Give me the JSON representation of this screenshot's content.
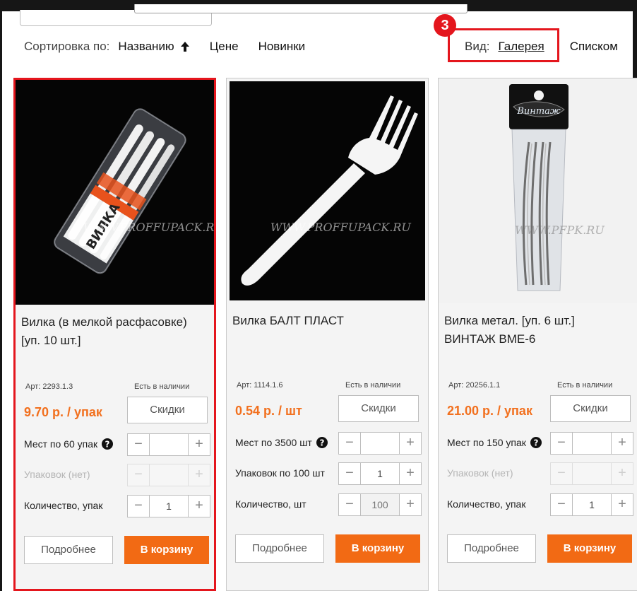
{
  "sort": {
    "label": "Сортировка по:",
    "options": [
      "Названию",
      "Цене",
      "Новинки"
    ]
  },
  "view": {
    "label": "Вид:",
    "gallery": "Галерея",
    "list": "Списком"
  },
  "step_badge": "3",
  "colors": {
    "accent": "#f26a14",
    "price": "#f2701e",
    "highlight": "#e4161d"
  },
  "products": [
    {
      "name": "Вилка (в мелкой расфасовке) [уп. 10 шт.]",
      "watermark": "WWW.PROFFUPACK.RU",
      "package_text": "ВИЛКА",
      "art": "Арт: 2293.1.3",
      "availability": "Есть в наличии",
      "price": "9.70 р. / упак",
      "discount_btn": "Скидки",
      "places_label": "Мест по 60 упак",
      "places_value": "",
      "packs_label": "Упаковок (нет)",
      "packs_value": "",
      "qty_label": "Количество, упак",
      "qty_value": "1",
      "more_btn": "Подробнее",
      "cart_btn": "В корзину"
    },
    {
      "name": "Вилка БАЛТ ПЛАСТ",
      "watermark": "WWW.PROFFUPACK.RU",
      "art": "Арт: 1114.1.6",
      "availability": "Есть в наличии",
      "price": "0.54 р. / шт",
      "discount_btn": "Скидки",
      "places_label": "Мест по 3500 шт",
      "places_value": "",
      "packs_label": "Упаковок по 100 шт",
      "packs_value": "1",
      "qty_label": "Количество, шт",
      "qty_value": "100",
      "more_btn": "Подробнее",
      "cart_btn": "В корзину"
    },
    {
      "name": "Вилка метал. [уп. 6 шт.] ВИНТАЖ ВМЕ-6",
      "watermark": "WWW.PFPK.RU",
      "package_text": "Винтаж",
      "art": "Арт: 20256.1.1",
      "availability": "Есть в наличии",
      "price": "21.00 р. / упак",
      "discount_btn": "Скидки",
      "places_label": "Мест по 150 упак",
      "places_value": "",
      "packs_label": "Упаковок (нет)",
      "packs_value": "",
      "qty_label": "Количество, упак",
      "qty_value": "1",
      "more_btn": "Подробнее",
      "cart_btn": "В корзину"
    }
  ]
}
